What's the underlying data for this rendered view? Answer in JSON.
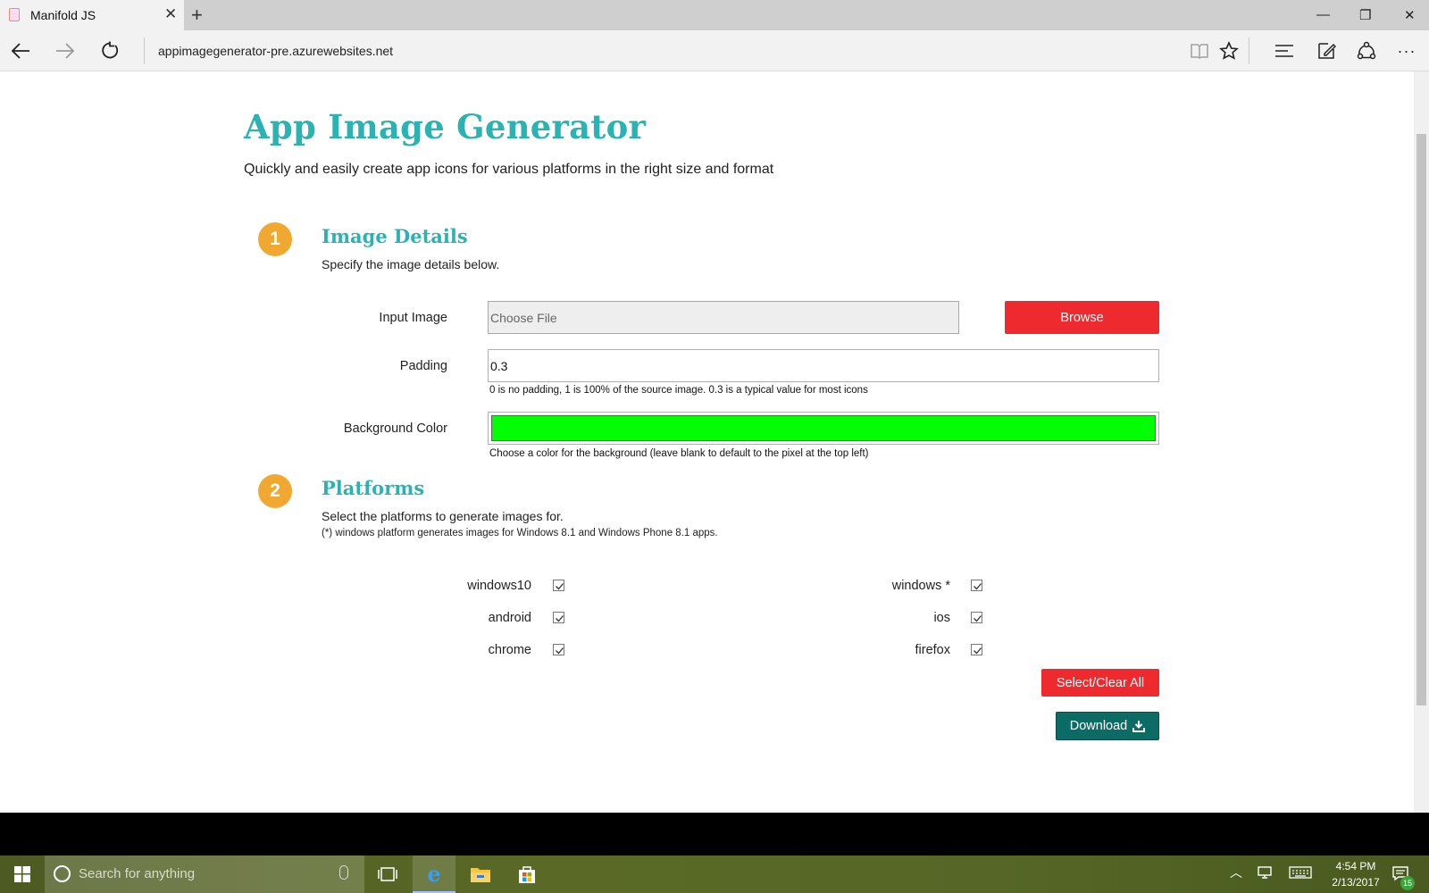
{
  "browser": {
    "tab_title": "Manifold JS",
    "url": "appimagegenerator-pre.azurewebsites.net"
  },
  "page": {
    "title": "App Image Generator",
    "subtitle": "Quickly and easily create app icons for various platforms in the right size and format",
    "step1": {
      "number": "1",
      "title": "Image Details",
      "subtitle": "Specify the image details below.",
      "input_image_label": "Input Image",
      "file_placeholder": "Choose File",
      "browse_label": "Browse",
      "padding_label": "Padding",
      "padding_value": "0.3",
      "padding_hint": "0 is no padding, 1 is 100% of the source image. 0.3 is a typical value for most icons",
      "bg_color_label": "Background Color",
      "bg_color_value": "#00ff00",
      "bg_color_hint": "Choose a color for the background (leave blank to default to the pixel at the top left)"
    },
    "step2": {
      "number": "2",
      "title": "Platforms",
      "subtitle": "Select the platforms to generate images for.",
      "note": "(*) windows platform generates images for Windows 8.1 and Windows Phone 8.1 apps.",
      "platforms": [
        {
          "label": "windows10",
          "checked": true
        },
        {
          "label": "windows *",
          "checked": true
        },
        {
          "label": "android",
          "checked": true
        },
        {
          "label": "ios",
          "checked": true
        },
        {
          "label": "chrome",
          "checked": true
        },
        {
          "label": "firefox",
          "checked": true
        }
      ],
      "select_clear_label": "Select/Clear All",
      "download_label": "Download"
    }
  },
  "taskbar": {
    "search_placeholder": "Search for anything",
    "time": "4:54 PM",
    "date": "2/13/2017",
    "notification_count": "15"
  },
  "colors": {
    "accent_teal": "#2bb3b3",
    "step_badge": "#f0a830",
    "button_red": "#ee2a2e",
    "download_teal": "#0d6b66"
  }
}
